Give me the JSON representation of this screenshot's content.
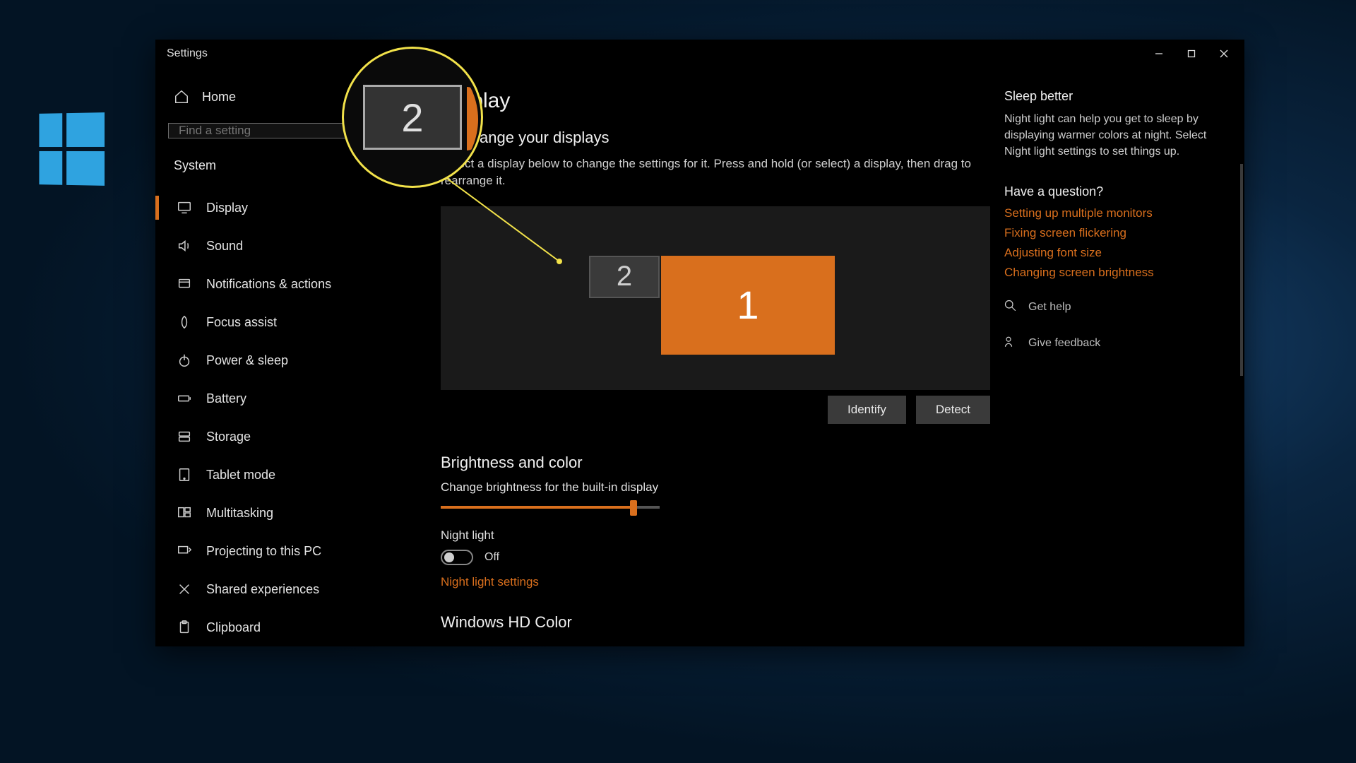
{
  "window": {
    "title": "Settings"
  },
  "sidebar": {
    "home": "Home",
    "search_placeholder": "Find a setting",
    "category": "System",
    "items": [
      {
        "icon": "display",
        "label": "Display"
      },
      {
        "icon": "sound",
        "label": "Sound"
      },
      {
        "icon": "notifications",
        "label": "Notifications & actions"
      },
      {
        "icon": "focus",
        "label": "Focus assist"
      },
      {
        "icon": "power",
        "label": "Power & sleep"
      },
      {
        "icon": "battery",
        "label": "Battery"
      },
      {
        "icon": "storage",
        "label": "Storage"
      },
      {
        "icon": "tablet",
        "label": "Tablet mode"
      },
      {
        "icon": "multitask",
        "label": "Multitasking"
      },
      {
        "icon": "projecting",
        "label": "Projecting to this PC"
      },
      {
        "icon": "shared",
        "label": "Shared experiences"
      },
      {
        "icon": "clipboard",
        "label": "Clipboard"
      }
    ],
    "active_index": 0
  },
  "page": {
    "title": "Display",
    "rearrange": {
      "heading": "Rearrange your displays",
      "helper": "Select a display below to change the settings for it. Press and hold (or select) a display, then drag to rearrange it.",
      "displays": [
        {
          "id": "1",
          "primary": true
        },
        {
          "id": "2",
          "primary": false
        }
      ],
      "identify": "Identify",
      "detect": "Detect"
    },
    "brightness": {
      "heading": "Brightness and color",
      "slider_label": "Change brightness for the built-in display",
      "slider_percent": 88,
      "night_light_label": "Night light",
      "night_light_state": "Off",
      "night_light_link": "Night light settings"
    },
    "hd_color_heading": "Windows HD Color"
  },
  "right": {
    "sleep_title": "Sleep better",
    "sleep_body": "Night light can help you get to sleep by displaying warmer colors at night. Select Night light settings to set things up.",
    "question_title": "Have a question?",
    "links": [
      "Setting up multiple monitors",
      "Fixing screen flickering",
      "Adjusting font size",
      "Changing screen brightness"
    ],
    "get_help": "Get help",
    "give_feedback": "Give feedback"
  },
  "callout": {
    "magnified_display_id": "2"
  }
}
